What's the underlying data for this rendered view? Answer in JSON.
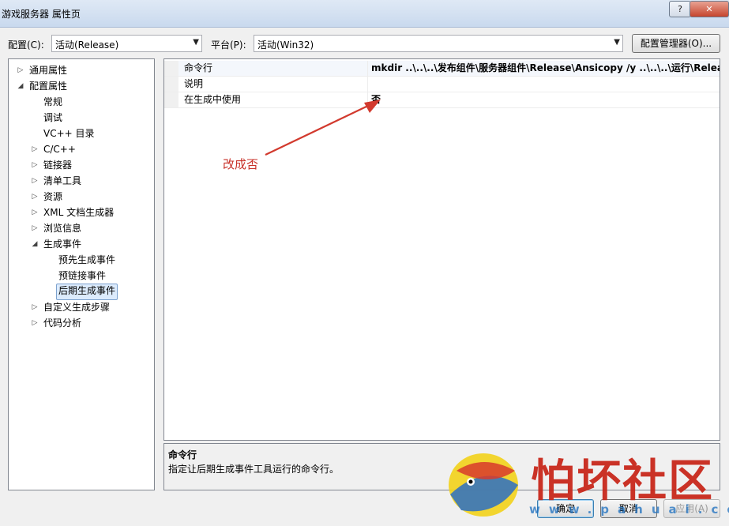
{
  "window": {
    "title": "游戏服务器 属性页",
    "help_button": "?",
    "close_button": "✕"
  },
  "config_bar": {
    "config_label": "配置(C):",
    "config_value": "活动(Release)",
    "platform_label": "平台(P):",
    "platform_value": "活动(Win32)",
    "manager_button": "配置管理器(O)..."
  },
  "tree": {
    "items": [
      {
        "label": "通用属性",
        "toggle": "▷",
        "level": 0
      },
      {
        "label": "配置属性",
        "toggle": "◢",
        "level": 0
      },
      {
        "label": "常规",
        "toggle": "",
        "level": 1
      },
      {
        "label": "调试",
        "toggle": "",
        "level": 1
      },
      {
        "label": "VC++ 目录",
        "toggle": "",
        "level": 1
      },
      {
        "label": "C/C++",
        "toggle": "▷",
        "level": 1
      },
      {
        "label": "链接器",
        "toggle": "▷",
        "level": 1
      },
      {
        "label": "清单工具",
        "toggle": "▷",
        "level": 1
      },
      {
        "label": "资源",
        "toggle": "▷",
        "level": 1
      },
      {
        "label": "XML 文档生成器",
        "toggle": "▷",
        "level": 1
      },
      {
        "label": "浏览信息",
        "toggle": "▷",
        "level": 1
      },
      {
        "label": "生成事件",
        "toggle": "◢",
        "level": 1
      },
      {
        "label": "预先生成事件",
        "toggle": "",
        "level": 2
      },
      {
        "label": "预链接事件",
        "toggle": "",
        "level": 2
      },
      {
        "label": "后期生成事件",
        "toggle": "",
        "level": 2,
        "selected": true
      },
      {
        "label": "自定义生成步骤",
        "toggle": "▷",
        "level": 1
      },
      {
        "label": "代码分析",
        "toggle": "▷",
        "level": 1
      }
    ]
  },
  "grid": {
    "rows": [
      {
        "name": "命令行",
        "value": "mkdir ..\\..\\..\\发布组件\\服务器组件\\Release\\Ansicopy /y ..\\..\\..\\运行\\Release\\"
      },
      {
        "name": "说明",
        "value": ""
      },
      {
        "name": "在生成中使用",
        "value": "否"
      }
    ]
  },
  "annotation": {
    "text": "改成否",
    "color": "#c8322a"
  },
  "description": {
    "title": "命令行",
    "text": "指定让后期生成事件工具运行的命令行。"
  },
  "buttons": {
    "ok": "确定",
    "cancel": "取消",
    "apply": "应用(A)"
  },
  "watermark": {
    "text": "怕坏社区",
    "url": "www.pahuai.com"
  }
}
